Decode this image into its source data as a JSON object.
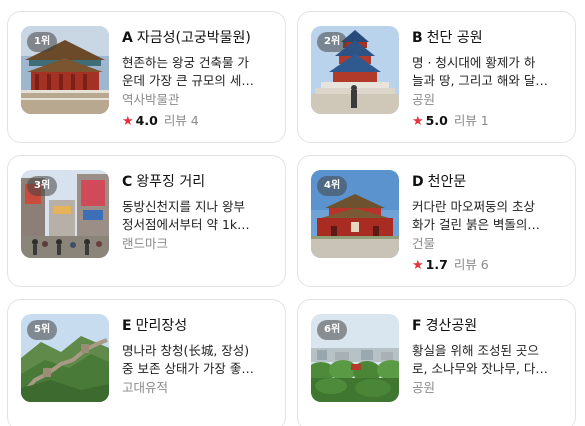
{
  "places": [
    {
      "rank": "1위",
      "letter": "A",
      "name": "자금성(고궁박물원)",
      "desc_line1": "현존하는 왕궁 건축물 가",
      "desc_line2": "운데 가장 큰 규모의 세…",
      "category": "역사박물관",
      "rating": "4.0",
      "reviews": "리뷰 4"
    },
    {
      "rank": "2위",
      "letter": "B",
      "name": "천단 공원",
      "desc_line1": "명 · 청시대에 황제가 하",
      "desc_line2": "늘과 땅, 그리고 해와 달…",
      "category": "공원",
      "rating": "5.0",
      "reviews": "리뷰 1"
    },
    {
      "rank": "3위",
      "letter": "C",
      "name": "왕푸징 거리",
      "desc_line1": "동방신천지를 지나 왕부",
      "desc_line2": "정서점에서부터 약 1k…",
      "category": "랜드마크"
    },
    {
      "rank": "4위",
      "letter": "D",
      "name": "천안문",
      "desc_line1": "커다란 마오쩌둥의 초상",
      "desc_line2": "화가 걸린 붉은 벽돌의…",
      "category": "건물",
      "rating": "1.7",
      "reviews": "리뷰 6"
    },
    {
      "rank": "5위",
      "letter": "E",
      "name": "만리장성",
      "desc_line1": "명나라 창청(长城, 장성)",
      "desc_line2": "중 보존 상태가 가장 좋…",
      "category": "고대유적"
    },
    {
      "rank": "6위",
      "letter": "F",
      "name": "경산공원",
      "desc_line1": "황실을 위해 조성된 곳으",
      "desc_line2": "로, 소나무와 잣나무, 다…",
      "category": "공원"
    }
  ],
  "star_glyph": "★",
  "star_color": "#e8303a"
}
